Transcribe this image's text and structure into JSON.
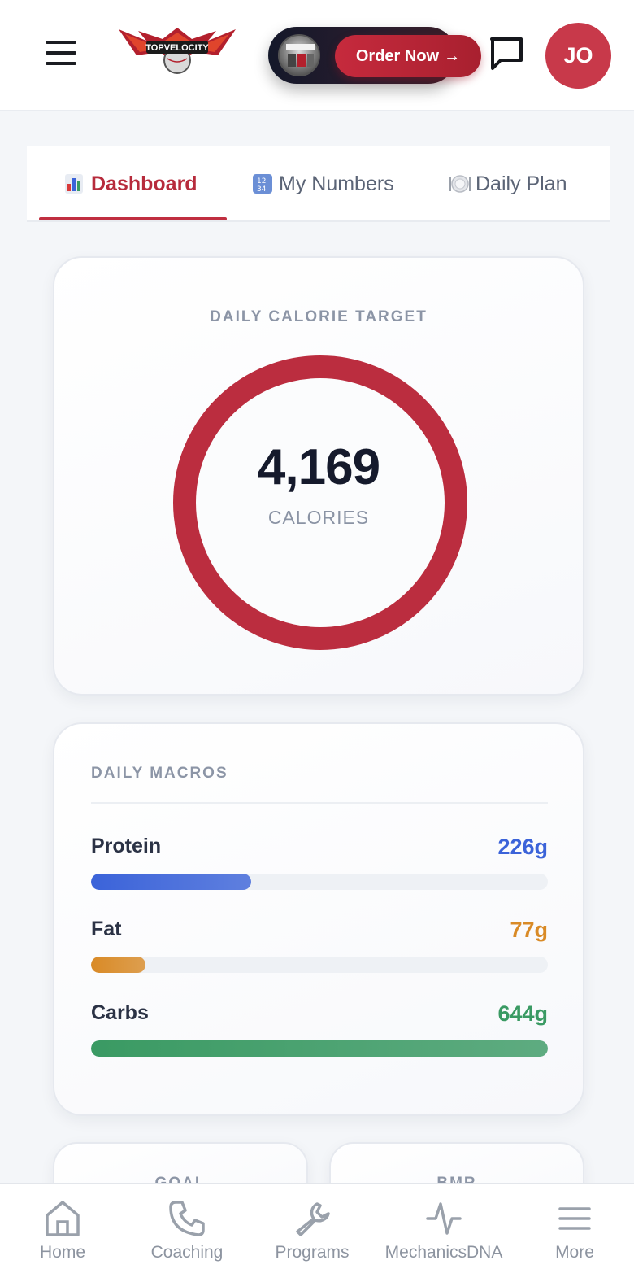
{
  "header": {
    "logo_text": "TOPVELOCITY",
    "order_button_label": "Order Now",
    "order_button_arrow": "→",
    "avatar_initials": "JO"
  },
  "tabs": [
    {
      "label": "Dashboard",
      "icon": "bar-chart-icon",
      "active": true
    },
    {
      "label": "My Numbers",
      "icon": "numbers-icon",
      "active": false
    },
    {
      "label": "Daily Plan",
      "icon": "plate-icon",
      "active": false
    }
  ],
  "calorie_card": {
    "title": "DAILY CALORIE TARGET",
    "value": "4,169",
    "unit": "CALORIES"
  },
  "macros_card": {
    "title": "DAILY MACROS",
    "items": [
      {
        "name": "Protein",
        "value": "226g",
        "fill_fraction": 0.35,
        "color": "#3b63d9"
      },
      {
        "name": "Fat",
        "value": "77g",
        "fill_fraction": 0.12,
        "color": "#d98a26"
      },
      {
        "name": "Carbs",
        "value": "644g",
        "fill_fraction": 1.0,
        "color": "#3a9a63"
      }
    ]
  },
  "small_cards": [
    {
      "label": "GOAL"
    },
    {
      "label": "BMR"
    }
  ],
  "bottom_nav": [
    {
      "label": "Home",
      "icon": "home-icon"
    },
    {
      "label": "Coaching",
      "icon": "phone-icon"
    },
    {
      "label": "Programs",
      "icon": "wrench-icon"
    },
    {
      "label": "MechanicsDNA",
      "icon": "pulse-icon"
    },
    {
      "label": "More",
      "icon": "menu-icon"
    }
  ],
  "colors": {
    "brand_red": "#c02f40",
    "protein": "#3b63d9",
    "fat": "#d98a26",
    "carbs": "#3a9a63"
  }
}
